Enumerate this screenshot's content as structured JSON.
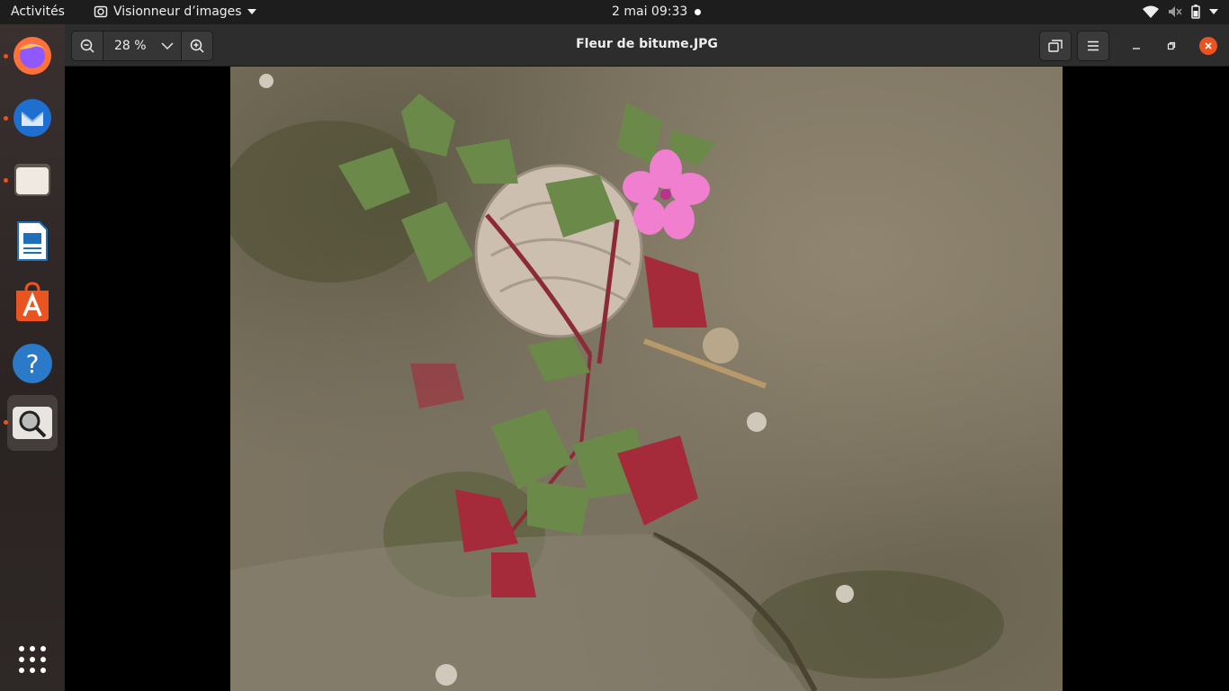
{
  "topbar": {
    "activities": "Activités",
    "app_menu": "Visionneur d’images",
    "clock": "2 mai  09:33"
  },
  "dock": {
    "items": [
      {
        "name": "firefox",
        "running": true
      },
      {
        "name": "thunderbird",
        "running": true
      },
      {
        "name": "files",
        "running": true
      },
      {
        "name": "libreoffice-writer",
        "running": false
      },
      {
        "name": "ubuntu-software",
        "running": false
      },
      {
        "name": "help",
        "running": false
      },
      {
        "name": "image-viewer",
        "running": true,
        "active": true
      }
    ],
    "show_apps_icon": "grid-icon"
  },
  "header": {
    "zoom_value": "28 %",
    "title": "Fleur de bitume.JPG"
  },
  "colors": {
    "accent": "#e95420",
    "topbar_bg": "#1d1d1d",
    "headerbar_bg": "#2d2d2d"
  }
}
